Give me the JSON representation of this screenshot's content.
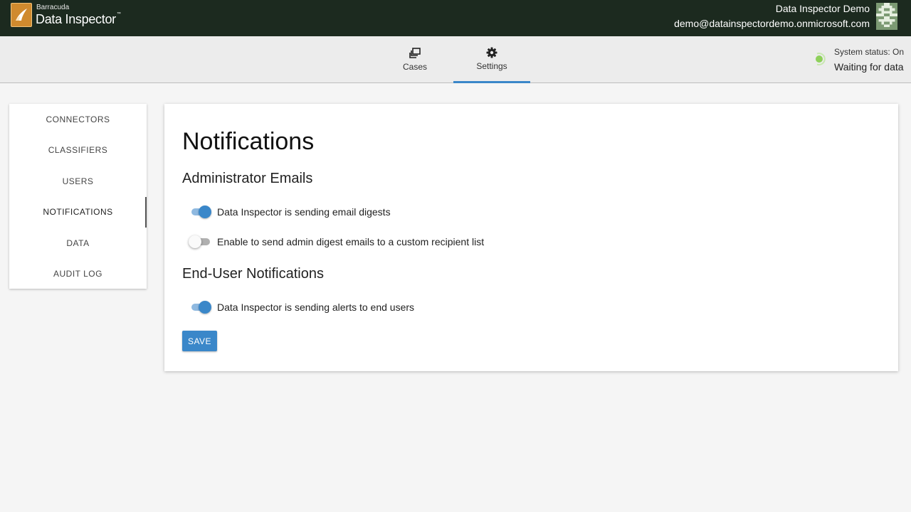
{
  "header": {
    "brand_small": "Barracuda",
    "brand_name": "Data Inspector",
    "trademark": "™",
    "user_name": "Data Inspector Demo",
    "user_email": "demo@datainspectordemo.onmicrosoft.com"
  },
  "nav": {
    "tabs": [
      {
        "label": "Cases",
        "icon": "cases-icon",
        "active": false
      },
      {
        "label": "Settings",
        "icon": "gear-icon",
        "active": true
      }
    ]
  },
  "system_status": {
    "title": "System status: On",
    "detail": "Waiting for data",
    "color": "#8ed05a"
  },
  "sidebar": {
    "items": [
      {
        "label": "CONNECTORS",
        "active": false
      },
      {
        "label": "CLASSIFIERS",
        "active": false
      },
      {
        "label": "USERS",
        "active": false
      },
      {
        "label": "NOTIFICATIONS",
        "active": true
      },
      {
        "label": "DATA",
        "active": false
      },
      {
        "label": "AUDIT LOG",
        "active": false
      }
    ]
  },
  "main": {
    "title": "Notifications",
    "admin_section": {
      "title": "Administrator Emails",
      "toggles": [
        {
          "label": "Data Inspector is sending email digests",
          "on": true
        },
        {
          "label": "Enable to send admin digest emails to a custom recipient list",
          "on": false
        }
      ]
    },
    "enduser_section": {
      "title": "End-User Notifications",
      "toggles": [
        {
          "label": "Data Inspector is sending alerts to end users",
          "on": true
        }
      ]
    },
    "save_label": "SAVE"
  },
  "colors": {
    "topbar": "#1c2a1f",
    "accent": "#3a87c9",
    "logo": "#d08a2e"
  }
}
